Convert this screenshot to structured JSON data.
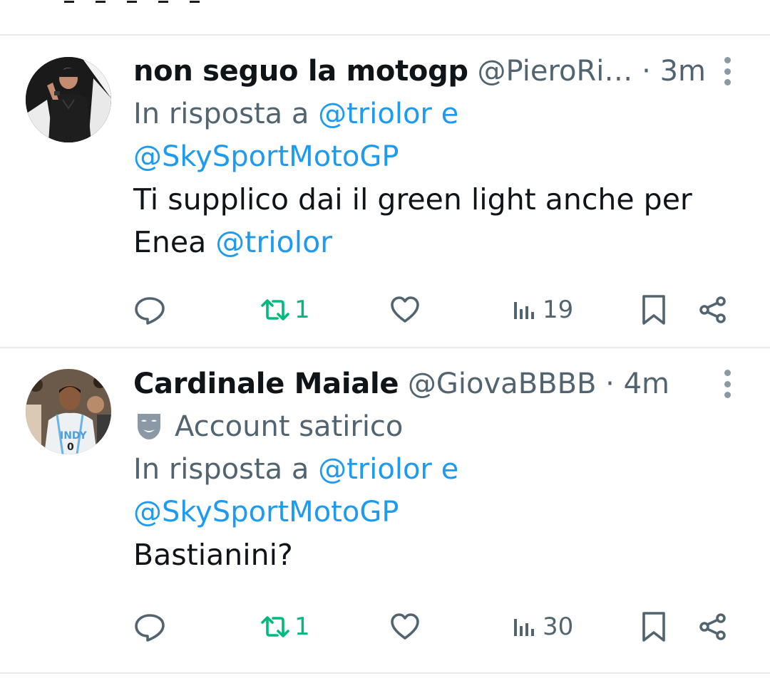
{
  "tweets": [
    {
      "name": "non seguo la motogp",
      "handle": "@PieroRi…",
      "time": "· 3m",
      "reply_prefix": "In risposta a",
      "reply_user_1": "@triolor",
      "reply_join": "e",
      "reply_user_2": "@SkySportMotoGP",
      "text_line_1": "Ti supplico dai il green light anche per",
      "text_line_2": "Enea",
      "text_mention": "@triolor",
      "retweets": "1",
      "views": "19"
    },
    {
      "name": "Cardinale Maiale",
      "handle": "@GiovaBBBB",
      "time": "· 4m",
      "label": "Account satirico",
      "reply_prefix": "In risposta a",
      "reply_user_1": "@triolor",
      "reply_join": "e",
      "reply_user_2": "@SkySportMotoGP",
      "text_line_1": "Bastianini?",
      "retweets": "1",
      "views": "30"
    }
  ],
  "icons": {
    "reply": "speech-bubble-icon",
    "retweet": "retweet-icon",
    "like": "heart-icon",
    "views": "bar-chart-icon",
    "bookmark": "bookmark-icon",
    "share": "share-icon",
    "more": "more-vertical-icon",
    "satirical": "theater-mask-icon"
  },
  "colors": {
    "text": "#0f1419",
    "secondary": "#536471",
    "link": "#1d9bf0",
    "retweeted": "#00ba7c",
    "divider": "#e7e9ea"
  }
}
